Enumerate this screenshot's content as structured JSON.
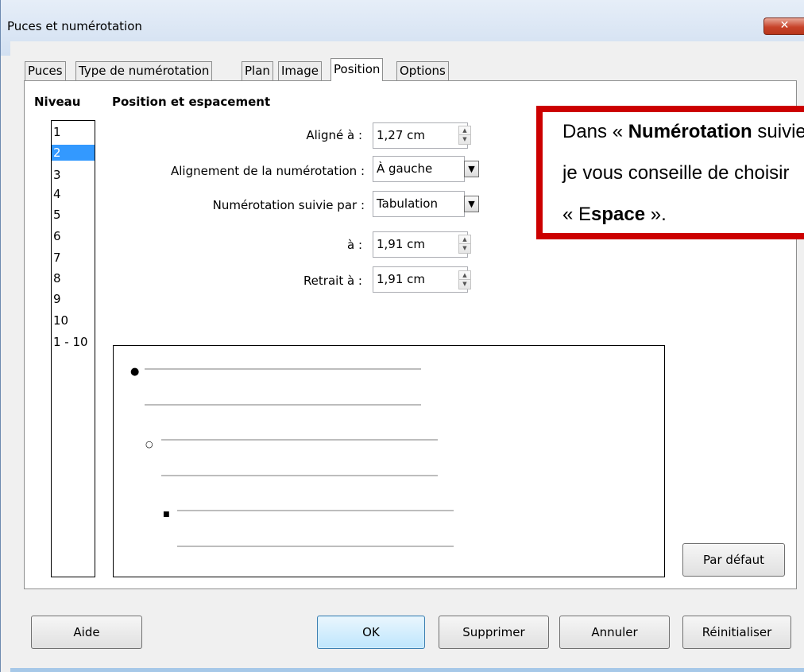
{
  "dialog": {
    "title": "Puces et numérotation",
    "close_label": "✕"
  },
  "tabs": [
    {
      "label": "Puces"
    },
    {
      "label": "Type de numérotation"
    },
    {
      "label": "Plan"
    },
    {
      "label": "Image"
    },
    {
      "label": "Position",
      "active": true
    },
    {
      "label": "Options"
    }
  ],
  "level": {
    "heading": "Niveau",
    "items": [
      "1",
      "2",
      "3",
      "4",
      "5",
      "6",
      "7",
      "8",
      "9",
      "10",
      "1 - 10"
    ],
    "selected": "2"
  },
  "position": {
    "heading": "Position et espacement",
    "aligned_label": "Aligné à :",
    "aligned_value": "1,27 cm",
    "alignment_label": "Alignement de la numérotation :",
    "alignment_value": "À gauche",
    "followed_label": "Numérotation suivie par :",
    "followed_value": "Tabulation",
    "at_label": "à :",
    "at_value": "1,91 cm",
    "indent_label": "Retrait à :",
    "indent_value": "1,91 cm"
  },
  "preview": {
    "bullets": [
      "●",
      "○",
      "■"
    ]
  },
  "default_button": "Par défaut",
  "buttons": {
    "help": "Aide",
    "ok": "OK",
    "delete": "Supprimer",
    "cancel": "Annuler",
    "reset": "Réinitialiser"
  },
  "callout": {
    "line1_prefix": "Dans « ",
    "line1_bold": "Numérotation",
    "line1_suffix": " suivie par »,",
    "line2": "je vous conseille de choisir",
    "line3_prefix": "« E",
    "line3_bold": "space",
    "line3_suffix": " »."
  },
  "colors": {
    "selection": "#3399ff",
    "callout_border": "#cc0000",
    "close_button": "#c7432a"
  }
}
